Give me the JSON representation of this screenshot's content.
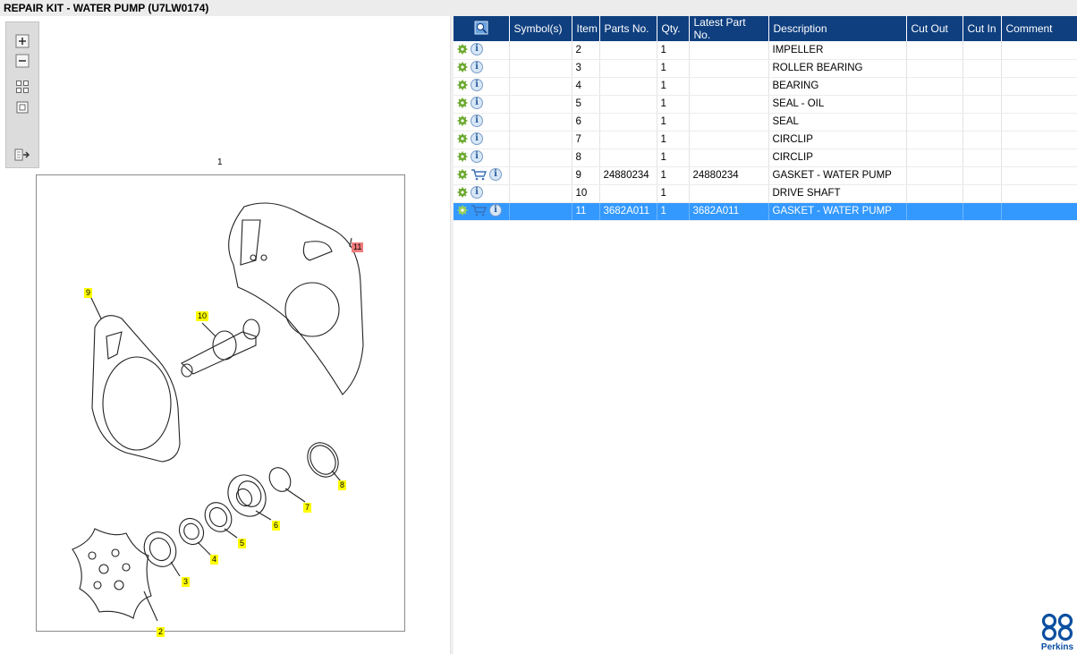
{
  "window": {
    "title": "REPAIR KIT - WATER PUMP (U7LW0174)"
  },
  "toolbar": {
    "zoom_in": "zoom-in-icon",
    "zoom_out": "zoom-out-icon",
    "fit_all": "fit-all-icon",
    "fit_window": "fit-window-icon",
    "toggle_panel": "toggle-panel-icon"
  },
  "diagram": {
    "reference_label": "1",
    "callouts": [
      {
        "id": "c11",
        "text": "11",
        "selected": true
      },
      {
        "id": "c9",
        "text": "9"
      },
      {
        "id": "c10",
        "text": "10"
      },
      {
        "id": "c8",
        "text": "8"
      },
      {
        "id": "c7",
        "text": "7"
      },
      {
        "id": "c6",
        "text": "6"
      },
      {
        "id": "c5",
        "text": "5"
      },
      {
        "id": "c4",
        "text": "4"
      },
      {
        "id": "c3",
        "text": "3"
      },
      {
        "id": "c2",
        "text": "2"
      }
    ]
  },
  "table": {
    "columns": [
      "Symbol(s)",
      "Item",
      "Parts No.",
      "Qty.",
      "Latest Part No.",
      "Description",
      "Cut Out",
      "Cut In",
      "Comment"
    ],
    "rows": [
      {
        "item": "2",
        "parts_no": "",
        "qty": "1",
        "latest": "",
        "description": "IMPELLER",
        "cart": false
      },
      {
        "item": "3",
        "parts_no": "",
        "qty": "1",
        "latest": "",
        "description": "ROLLER BEARING",
        "cart": false
      },
      {
        "item": "4",
        "parts_no": "",
        "qty": "1",
        "latest": "",
        "description": "BEARING",
        "cart": false
      },
      {
        "item": "5",
        "parts_no": "",
        "qty": "1",
        "latest": "",
        "description": "SEAL - OIL",
        "cart": false
      },
      {
        "item": "6",
        "parts_no": "",
        "qty": "1",
        "latest": "",
        "description": "SEAL",
        "cart": false
      },
      {
        "item": "7",
        "parts_no": "",
        "qty": "1",
        "latest": "",
        "description": "CIRCLIP",
        "cart": false
      },
      {
        "item": "8",
        "parts_no": "",
        "qty": "1",
        "latest": "",
        "description": "CIRCLIP",
        "cart": false
      },
      {
        "item": "9",
        "parts_no": "24880234",
        "qty": "1",
        "latest": "24880234",
        "description": "GASKET - WATER PUMP",
        "cart": true
      },
      {
        "item": "10",
        "parts_no": "",
        "qty": "1",
        "latest": "",
        "description": "DRIVE SHAFT",
        "cart": false
      },
      {
        "item": "11",
        "parts_no": "3682A011",
        "qty": "1",
        "latest": "3682A011",
        "description": "GASKET - WATER PUMP",
        "cart": true,
        "selected": true
      }
    ]
  },
  "logo": {
    "text": "Perkins"
  },
  "colors": {
    "header": "#0f3f7f",
    "selection": "#3399ff",
    "callout": "#ffff00",
    "callout_selected": "#ef7b7b",
    "gear": "#6aa82c"
  }
}
